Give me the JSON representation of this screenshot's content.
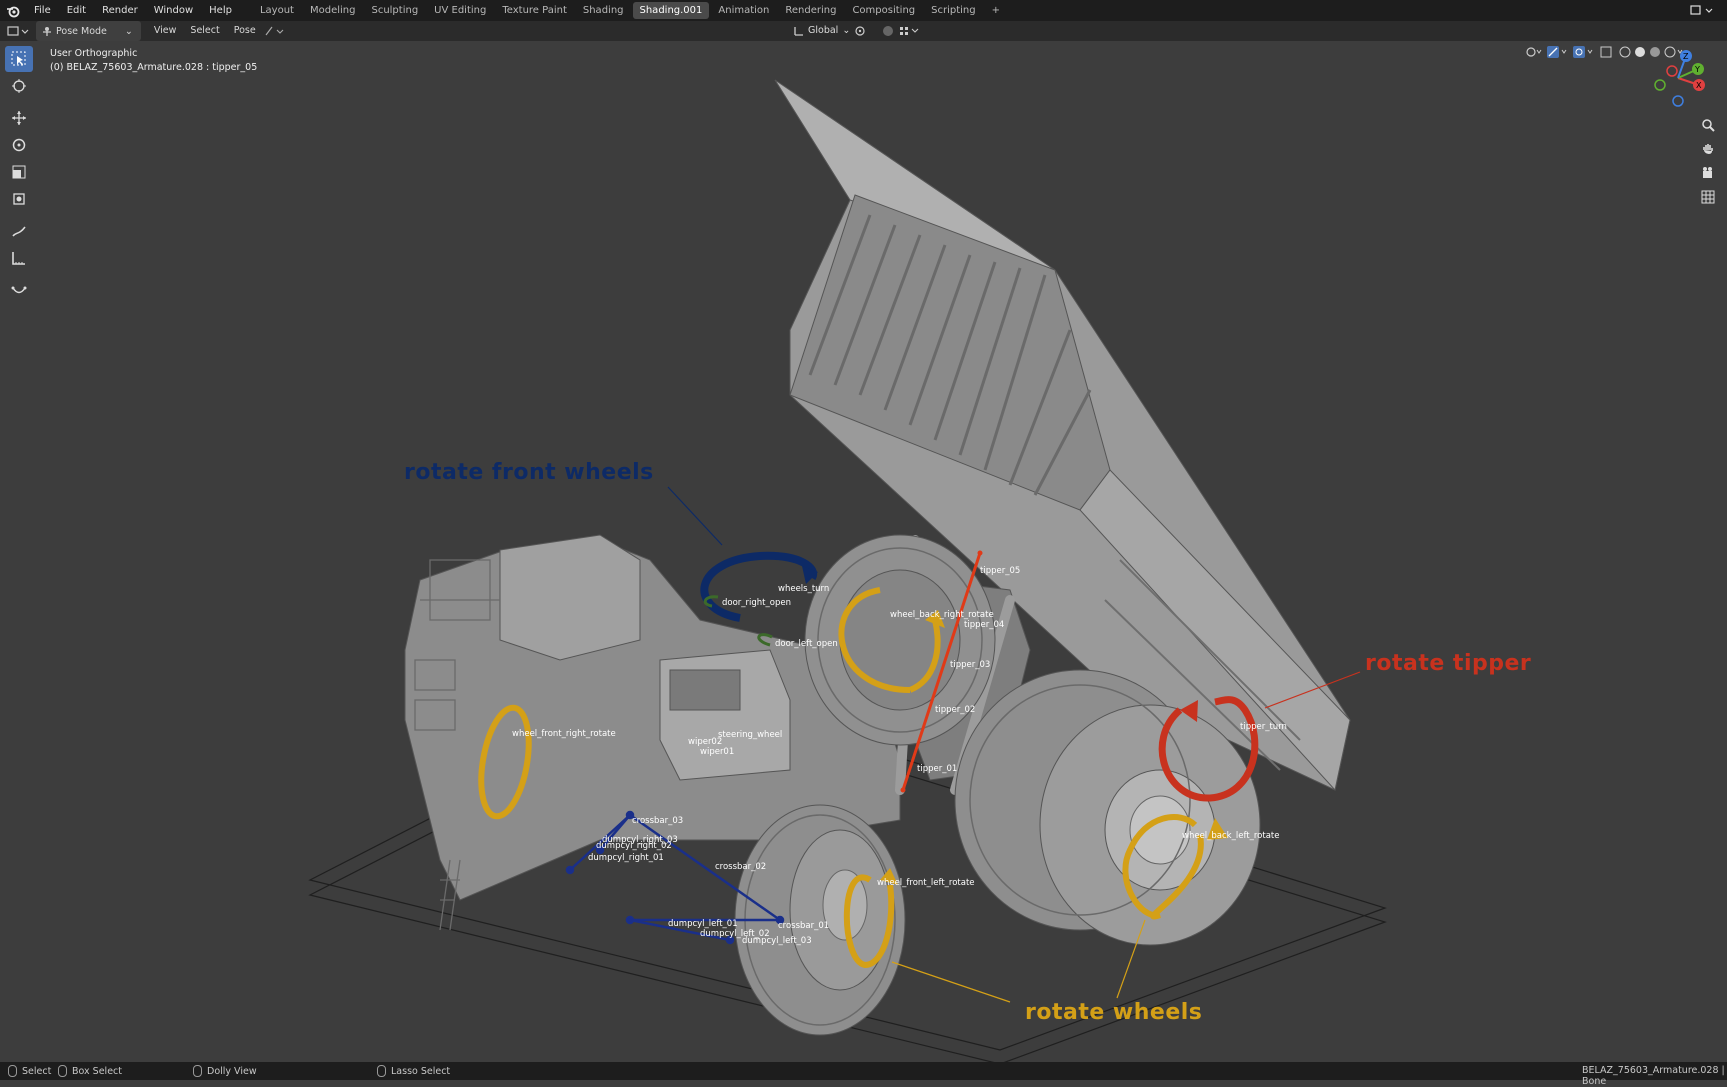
{
  "topbar": {
    "menus": [
      "File",
      "Edit",
      "Render",
      "Window",
      "Help"
    ],
    "workspaces": [
      "Layout",
      "Modeling",
      "Sculpting",
      "UV Editing",
      "Texture Paint",
      "Shading",
      "Shading.001",
      "Animation",
      "Rendering",
      "Compositing",
      "Scripting"
    ],
    "active_workspace": "Shading.001",
    "add_tab": "+"
  },
  "header": {
    "mode": "Pose Mode",
    "view": "View",
    "select": "Select",
    "pose": "Pose",
    "orientation": "Global"
  },
  "viewport": {
    "view_name": "User Orthographic",
    "active_object": "(0) BELAZ_75603_Armature.028 : tipper_05"
  },
  "annotations": {
    "front_wheels": "rotate front wheels",
    "tipper": "rotate tipper",
    "wheels": "rotate wheels"
  },
  "bones": {
    "wheels_turn": "wheels_turn",
    "door_right_open": "door_right_open",
    "door_left_open": "door_left_open",
    "wheel_back_right_rotate": "wheel_back_right_rotate",
    "tipper_05": "tipper_05",
    "tipper_04": "tipper_04",
    "tipper_03": "tipper_03",
    "tipper_02": "tipper_02",
    "tipper_01": "tipper_01",
    "tipper_turn": "tipper_turn",
    "wheel_front_right_rotate": "wheel_front_right_rotate",
    "steering_wheel": "steering_wheel",
    "wiper02": "wiper02",
    "wiper01": "wiper01",
    "crossbar_03": "crossbar_03",
    "dumpcyl_right_03": "dumpcyl_right_03",
    "dumpcyl_right_02": "dumpcyl_right_02",
    "dumpcyl_right_01": "dumpcyl_right_01",
    "crossbar_02": "crossbar_02",
    "wheel_front_left_rotate": "wheel_front_left_rotate",
    "wheel_back_left_rotate": "wheel_back_left_rotate",
    "dumpcyl_left_01": "dumpcyl_left_01",
    "dumpcyl_left_02": "dumpcyl_left_02",
    "dumpcyl_left_03": "dumpcyl_left_03",
    "crossbar_01": "crossbar_01"
  },
  "gizmo": {
    "x": "X",
    "y": "Y",
    "z": "Z"
  },
  "statusbar": {
    "select": "Select",
    "box_select": "Box Select",
    "dolly_view": "Dolly View",
    "lasso_select": "Lasso Select",
    "right_info": "BELAZ_75603_Armature.028 | Bone"
  },
  "colors": {
    "front_wheels": "#0d2a66",
    "tipper": "#c8321e",
    "wheels": "#d4a017",
    "active_tab": "#4a4a4a",
    "active_tool": "#4772b3"
  }
}
